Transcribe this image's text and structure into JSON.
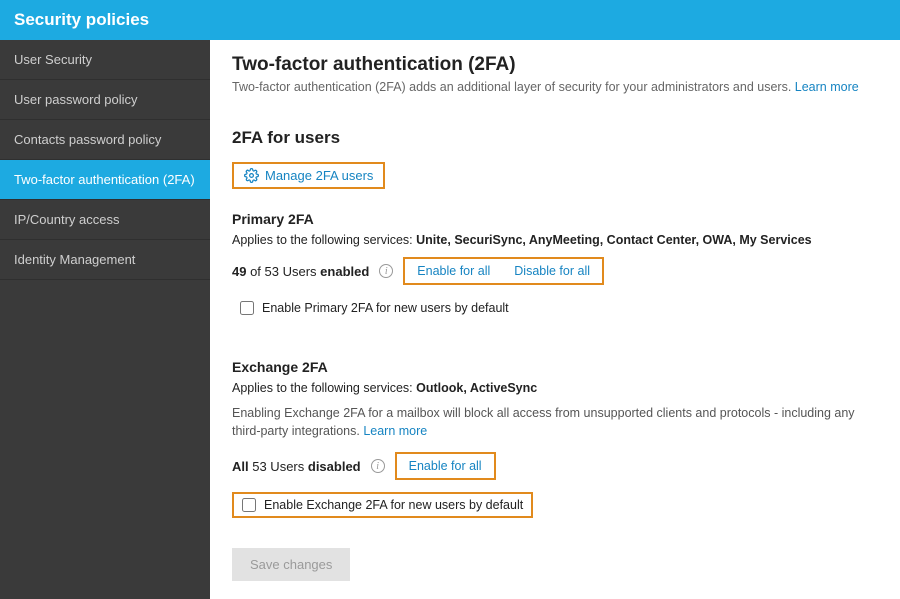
{
  "topbar": {
    "title": "Security policies"
  },
  "sidebar": {
    "items": [
      {
        "label": "User Security"
      },
      {
        "label": "User password policy"
      },
      {
        "label": "Contacts password policy"
      },
      {
        "label": "Two-factor authentication (2FA)"
      },
      {
        "label": "IP/Country access"
      },
      {
        "label": "Identity Management"
      }
    ]
  },
  "page": {
    "title": "Two-factor authentication (2FA)",
    "desc": "Two-factor authentication (2FA) adds an additional layer of security for your administrators and users. ",
    "learn_more": "Learn more"
  },
  "users_section": {
    "title": "2FA for users",
    "manage_link": "Manage 2FA users",
    "primary": {
      "title": "Primary 2FA",
      "applies_prefix": "Applies to the following services: ",
      "applies_services": "Unite, SecuriSync, AnyMeeting, Contact Center, OWA, My Services",
      "count_bold1": "49",
      "count_mid": " of 53 Users ",
      "count_bold2": "enabled",
      "enable_all": "Enable for all",
      "disable_all": "Disable for all",
      "default_label": "Enable Primary 2FA for new users by default"
    },
    "exchange": {
      "title": "Exchange 2FA",
      "applies_prefix": "Applies to the following services: ",
      "applies_services": "Outlook, ActiveSync",
      "note": "Enabling Exchange 2FA for a mailbox will block all access from unsupported clients and protocols - including any third-party integrations. ",
      "learn_more": "Learn more",
      "count_bold1": "All",
      "count_mid": " 53 Users ",
      "count_bold2": "disabled",
      "enable_all": "Enable for all",
      "default_label": "Enable Exchange 2FA for new users by default"
    }
  },
  "save_label": "Save changes"
}
